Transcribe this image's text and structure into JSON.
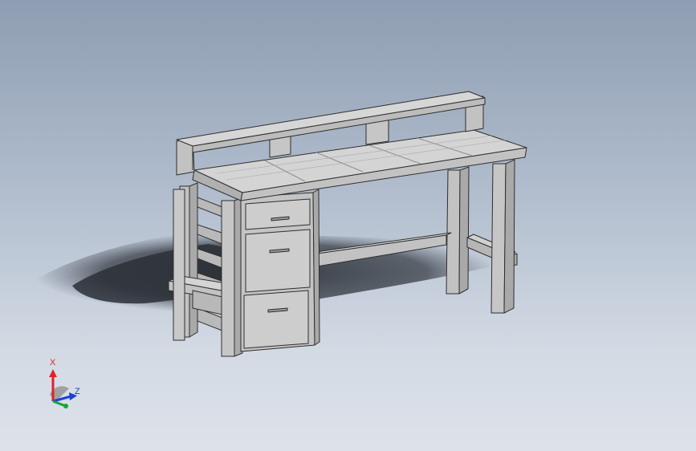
{
  "viewport": {
    "background_top": "#8e9db2",
    "background_bottom": "#dde2ea"
  },
  "model": {
    "face_top": "#d4d4d4",
    "face_front": "#c2c2c2",
    "face_side": "#a9a9a9",
    "edge": "#2e2e2e",
    "shadow": "#3a3f48",
    "handle": "#9a9a9a"
  },
  "triad": {
    "x_label": "X",
    "z_label": "Z",
    "x_color": "#e0222a",
    "y_color": "#17a43a",
    "z_color": "#1f3fd8"
  }
}
